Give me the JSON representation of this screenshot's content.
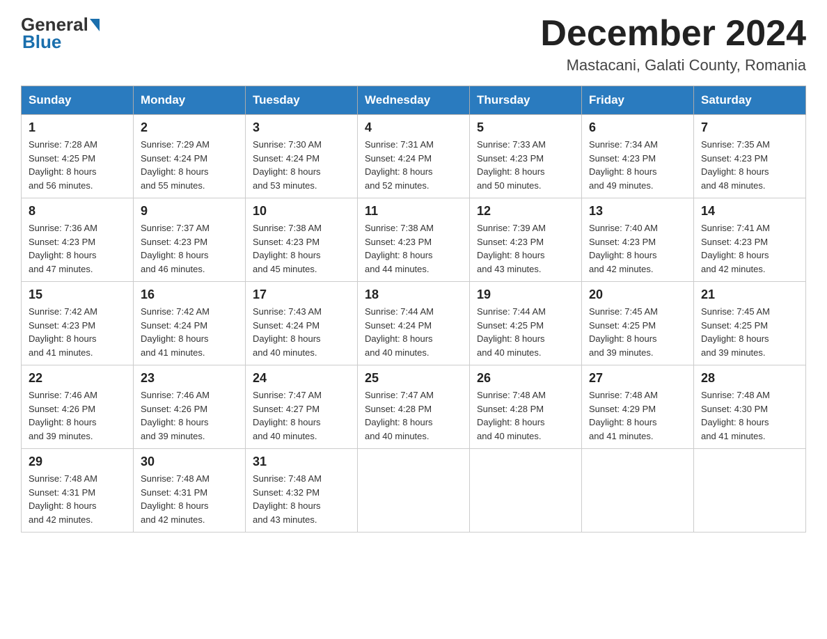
{
  "header": {
    "logo_general": "General",
    "logo_blue": "Blue",
    "month_title": "December 2024",
    "location": "Mastacani, Galati County, Romania"
  },
  "days_of_week": [
    "Sunday",
    "Monday",
    "Tuesday",
    "Wednesday",
    "Thursday",
    "Friday",
    "Saturday"
  ],
  "weeks": [
    [
      {
        "day": "1",
        "sunrise": "7:28 AM",
        "sunset": "4:25 PM",
        "daylight": "8 hours and 56 minutes."
      },
      {
        "day": "2",
        "sunrise": "7:29 AM",
        "sunset": "4:24 PM",
        "daylight": "8 hours and 55 minutes."
      },
      {
        "day": "3",
        "sunrise": "7:30 AM",
        "sunset": "4:24 PM",
        "daylight": "8 hours and 53 minutes."
      },
      {
        "day": "4",
        "sunrise": "7:31 AM",
        "sunset": "4:24 PM",
        "daylight": "8 hours and 52 minutes."
      },
      {
        "day": "5",
        "sunrise": "7:33 AM",
        "sunset": "4:23 PM",
        "daylight": "8 hours and 50 minutes."
      },
      {
        "day": "6",
        "sunrise": "7:34 AM",
        "sunset": "4:23 PM",
        "daylight": "8 hours and 49 minutes."
      },
      {
        "day": "7",
        "sunrise": "7:35 AM",
        "sunset": "4:23 PM",
        "daylight": "8 hours and 48 minutes."
      }
    ],
    [
      {
        "day": "8",
        "sunrise": "7:36 AM",
        "sunset": "4:23 PM",
        "daylight": "8 hours and 47 minutes."
      },
      {
        "day": "9",
        "sunrise": "7:37 AM",
        "sunset": "4:23 PM",
        "daylight": "8 hours and 46 minutes."
      },
      {
        "day": "10",
        "sunrise": "7:38 AM",
        "sunset": "4:23 PM",
        "daylight": "8 hours and 45 minutes."
      },
      {
        "day": "11",
        "sunrise": "7:38 AM",
        "sunset": "4:23 PM",
        "daylight": "8 hours and 44 minutes."
      },
      {
        "day": "12",
        "sunrise": "7:39 AM",
        "sunset": "4:23 PM",
        "daylight": "8 hours and 43 minutes."
      },
      {
        "day": "13",
        "sunrise": "7:40 AM",
        "sunset": "4:23 PM",
        "daylight": "8 hours and 42 minutes."
      },
      {
        "day": "14",
        "sunrise": "7:41 AM",
        "sunset": "4:23 PM",
        "daylight": "8 hours and 42 minutes."
      }
    ],
    [
      {
        "day": "15",
        "sunrise": "7:42 AM",
        "sunset": "4:23 PM",
        "daylight": "8 hours and 41 minutes."
      },
      {
        "day": "16",
        "sunrise": "7:42 AM",
        "sunset": "4:24 PM",
        "daylight": "8 hours and 41 minutes."
      },
      {
        "day": "17",
        "sunrise": "7:43 AM",
        "sunset": "4:24 PM",
        "daylight": "8 hours and 40 minutes."
      },
      {
        "day": "18",
        "sunrise": "7:44 AM",
        "sunset": "4:24 PM",
        "daylight": "8 hours and 40 minutes."
      },
      {
        "day": "19",
        "sunrise": "7:44 AM",
        "sunset": "4:25 PM",
        "daylight": "8 hours and 40 minutes."
      },
      {
        "day": "20",
        "sunrise": "7:45 AM",
        "sunset": "4:25 PM",
        "daylight": "8 hours and 39 minutes."
      },
      {
        "day": "21",
        "sunrise": "7:45 AM",
        "sunset": "4:25 PM",
        "daylight": "8 hours and 39 minutes."
      }
    ],
    [
      {
        "day": "22",
        "sunrise": "7:46 AM",
        "sunset": "4:26 PM",
        "daylight": "8 hours and 39 minutes."
      },
      {
        "day": "23",
        "sunrise": "7:46 AM",
        "sunset": "4:26 PM",
        "daylight": "8 hours and 39 minutes."
      },
      {
        "day": "24",
        "sunrise": "7:47 AM",
        "sunset": "4:27 PM",
        "daylight": "8 hours and 40 minutes."
      },
      {
        "day": "25",
        "sunrise": "7:47 AM",
        "sunset": "4:28 PM",
        "daylight": "8 hours and 40 minutes."
      },
      {
        "day": "26",
        "sunrise": "7:48 AM",
        "sunset": "4:28 PM",
        "daylight": "8 hours and 40 minutes."
      },
      {
        "day": "27",
        "sunrise": "7:48 AM",
        "sunset": "4:29 PM",
        "daylight": "8 hours and 41 minutes."
      },
      {
        "day": "28",
        "sunrise": "7:48 AM",
        "sunset": "4:30 PM",
        "daylight": "8 hours and 41 minutes."
      }
    ],
    [
      {
        "day": "29",
        "sunrise": "7:48 AM",
        "sunset": "4:31 PM",
        "daylight": "8 hours and 42 minutes."
      },
      {
        "day": "30",
        "sunrise": "7:48 AM",
        "sunset": "4:31 PM",
        "daylight": "8 hours and 42 minutes."
      },
      {
        "day": "31",
        "sunrise": "7:48 AM",
        "sunset": "4:32 PM",
        "daylight": "8 hours and 43 minutes."
      },
      null,
      null,
      null,
      null
    ]
  ],
  "labels": {
    "sunrise": "Sunrise:",
    "sunset": "Sunset:",
    "daylight": "Daylight:"
  }
}
